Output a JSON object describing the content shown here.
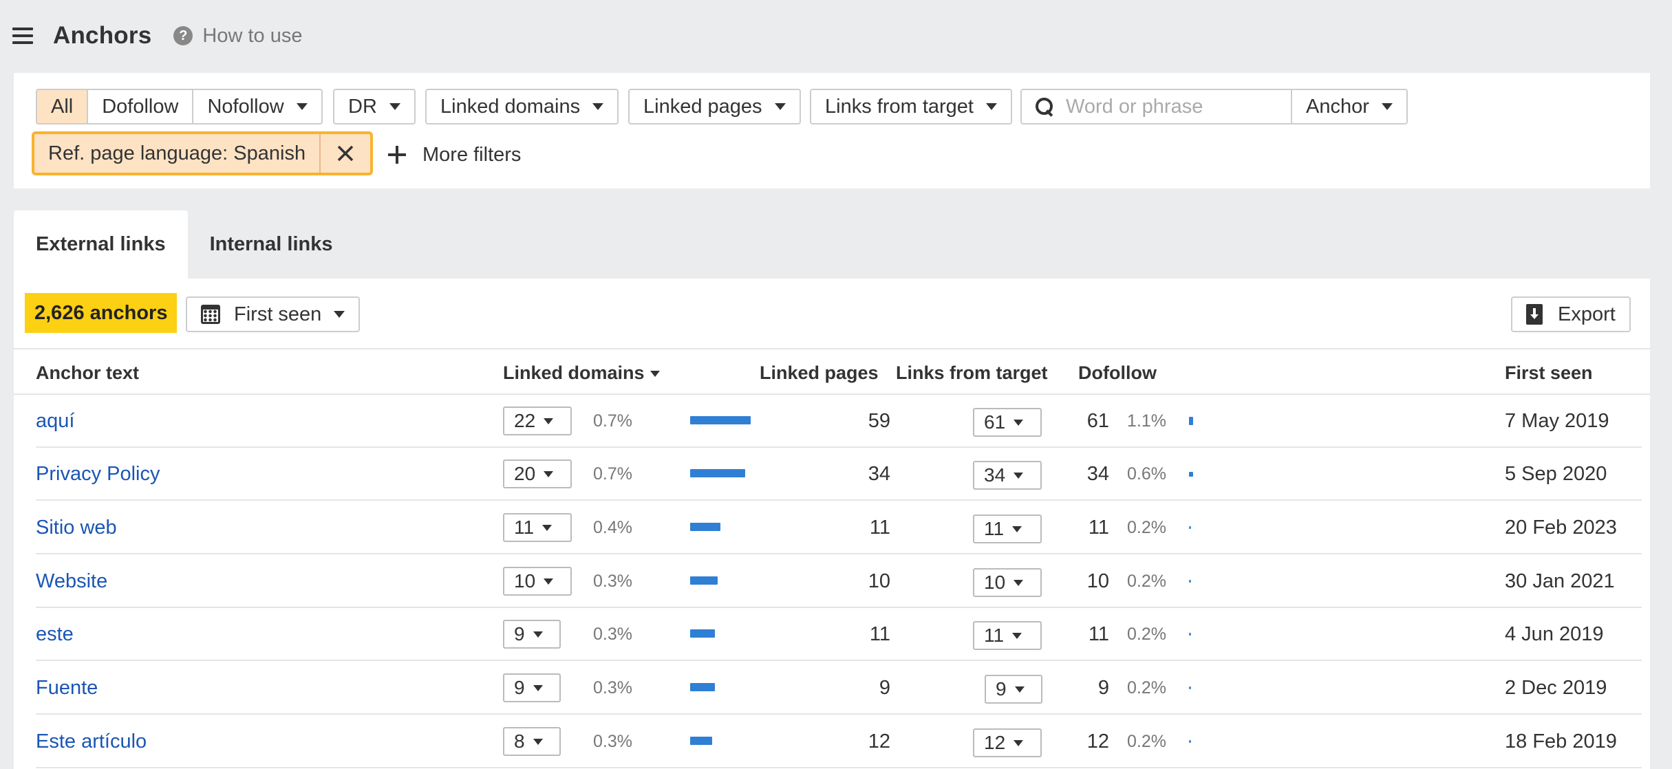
{
  "header": {
    "title": "Anchors",
    "help_label": "How to use"
  },
  "filters": {
    "link_type": [
      "All",
      "Dofollow",
      "Nofollow"
    ],
    "dr": "DR",
    "linked_domains": "Linked domains",
    "linked_pages": "Linked pages",
    "links_from_target": "Links from target",
    "search_placeholder": "Word or phrase",
    "search_mode": "Anchor",
    "active_filter": "Ref. page language: Spanish",
    "more_filters": "More filters"
  },
  "tabs": [
    "External links",
    "Internal links"
  ],
  "toolbar": {
    "count": "2,626 anchors",
    "sort_by": "First seen",
    "export": "Export"
  },
  "columns": [
    "Anchor text",
    "Linked domains",
    "Linked pages",
    "Links from target",
    "Dofollow",
    "First seen"
  ],
  "colors": {
    "accent": "#fcd013",
    "chip_border": "#f8b32e",
    "link": "#1a56b4",
    "bar": "#2f7fd5"
  },
  "rows": [
    {
      "anchor": "aquí",
      "linked_domains": "22",
      "domains_pct": "0.7%",
      "domains_share": 1.0,
      "linked_pages": "59",
      "links_from_target": "61",
      "dofollow": "61",
      "dofollow_pct": "1.1%",
      "dofollow_share": 1.1,
      "first_seen": "7 May 2019"
    },
    {
      "anchor": "Privacy Policy",
      "linked_domains": "20",
      "domains_pct": "0.7%",
      "domains_share": 0.91,
      "linked_pages": "34",
      "links_from_target": "34",
      "dofollow": "34",
      "dofollow_pct": "0.6%",
      "dofollow_share": 0.6,
      "first_seen": "5 Sep 2020"
    },
    {
      "anchor": "Sitio web",
      "linked_domains": "11",
      "domains_pct": "0.4%",
      "domains_share": 0.5,
      "linked_pages": "11",
      "links_from_target": "11",
      "dofollow": "11",
      "dofollow_pct": "0.2%",
      "dofollow_share": 0.2,
      "first_seen": "20 Feb 2023"
    },
    {
      "anchor": "Website",
      "linked_domains": "10",
      "domains_pct": "0.3%",
      "domains_share": 0.45,
      "linked_pages": "10",
      "links_from_target": "10",
      "dofollow": "10",
      "dofollow_pct": "0.2%",
      "dofollow_share": 0.2,
      "first_seen": "30 Jan 2021"
    },
    {
      "anchor": "este",
      "linked_domains": "9",
      "domains_pct": "0.3%",
      "domains_share": 0.41,
      "linked_pages": "11",
      "links_from_target": "11",
      "dofollow": "11",
      "dofollow_pct": "0.2%",
      "dofollow_share": 0.2,
      "first_seen": "4 Jun 2019"
    },
    {
      "anchor": "Fuente",
      "linked_domains": "9",
      "domains_pct": "0.3%",
      "domains_share": 0.41,
      "linked_pages": "9",
      "links_from_target": "9",
      "dofollow": "9",
      "dofollow_pct": "0.2%",
      "dofollow_share": 0.2,
      "first_seen": "2 Dec 2019"
    },
    {
      "anchor": "Este artículo",
      "linked_domains": "8",
      "domains_pct": "0.3%",
      "domains_share": 0.36,
      "linked_pages": "12",
      "links_from_target": "12",
      "dofollow": "12",
      "dofollow_pct": "0.2%",
      "dofollow_share": 0.2,
      "first_seen": "18 Feb 2019"
    }
  ]
}
